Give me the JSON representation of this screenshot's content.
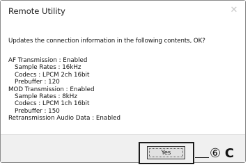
{
  "window": {
    "title": "Remote Utility"
  },
  "message": "Updates the connection information in the following contents, OK?",
  "info": {
    "af_transmission": "AF Transmission : Enabled",
    "af_sample_rates": "Sample Rates : 16kHz",
    "af_codecs": "Codecs : LPCM 2ch 16bit",
    "af_prebuffer": "Prebuffer : 120",
    "mod_transmission": "MOD Transmission : Enabled",
    "mod_sample_rates": "Sample Rates : 8kHz",
    "mod_codecs": "Codecs : LPCM 1ch 16bit",
    "mod_prebuffer": "Prebuffer : 150",
    "retransmission": "Retransmission Audio Data : Enabled"
  },
  "buttons": {
    "yes": "Yes"
  },
  "callout": {
    "number": "⑥",
    "letter": "C"
  }
}
